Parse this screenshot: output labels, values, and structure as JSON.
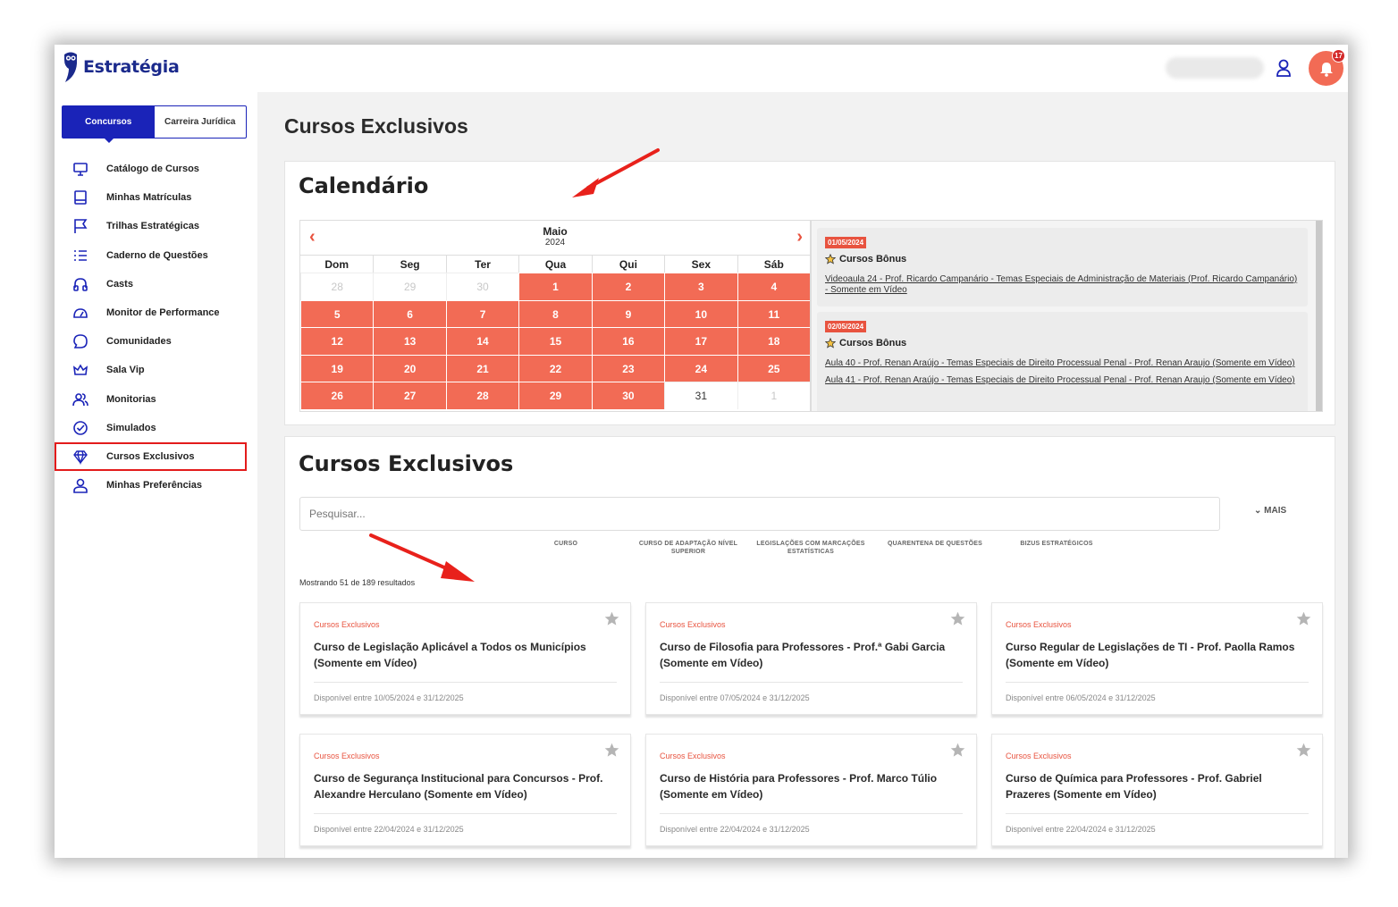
{
  "brand": {
    "name": "Estratégia"
  },
  "header": {
    "notifications_count": "17"
  },
  "sidebar": {
    "tabs": [
      {
        "label": "Concursos"
      },
      {
        "label": "Carreira Jurídica"
      }
    ],
    "items": [
      {
        "label": "Catálogo de Cursos",
        "icon": "monitor-icon"
      },
      {
        "label": "Minhas Matrículas",
        "icon": "book-icon"
      },
      {
        "label": "Trilhas Estratégicas",
        "icon": "flag-icon"
      },
      {
        "label": "Caderno de Questões",
        "icon": "list-icon"
      },
      {
        "label": "Casts",
        "icon": "headphones-icon"
      },
      {
        "label": "Monitor de Performance",
        "icon": "gauge-icon"
      },
      {
        "label": "Comunidades",
        "icon": "chat-icon"
      },
      {
        "label": "Sala Vip",
        "icon": "crown-icon"
      },
      {
        "label": "Monitorias",
        "icon": "users-icon"
      },
      {
        "label": "Simulados",
        "icon": "check-circle-icon"
      },
      {
        "label": "Cursos Exclusivos",
        "icon": "diamond-icon"
      },
      {
        "label": "Minhas Preferências",
        "icon": "user-icon"
      }
    ]
  },
  "main": {
    "title": "Cursos Exclusivos"
  },
  "calendar": {
    "title": "Calendário",
    "month": "Maio",
    "year": "2024",
    "weekdays": [
      "Dom",
      "Seg",
      "Ter",
      "Qua",
      "Qui",
      "Sex",
      "Sáb"
    ],
    "days": [
      {
        "d": "28",
        "s": "other"
      },
      {
        "d": "29",
        "s": "other"
      },
      {
        "d": "30",
        "s": "other"
      },
      {
        "d": "1",
        "s": "ev"
      },
      {
        "d": "2",
        "s": "ev"
      },
      {
        "d": "3",
        "s": "ev"
      },
      {
        "d": "4",
        "s": "ev"
      },
      {
        "d": "5",
        "s": "ev"
      },
      {
        "d": "6",
        "s": "ev"
      },
      {
        "d": "7",
        "s": "ev"
      },
      {
        "d": "8",
        "s": "ev"
      },
      {
        "d": "9",
        "s": "ev"
      },
      {
        "d": "10",
        "s": "ev"
      },
      {
        "d": "11",
        "s": "ev"
      },
      {
        "d": "12",
        "s": "ev"
      },
      {
        "d": "13",
        "s": "ev"
      },
      {
        "d": "14",
        "s": "ev"
      },
      {
        "d": "15",
        "s": "ev"
      },
      {
        "d": "16",
        "s": "ev"
      },
      {
        "d": "17",
        "s": "ev"
      },
      {
        "d": "18",
        "s": "ev"
      },
      {
        "d": "19",
        "s": "ev"
      },
      {
        "d": "20",
        "s": "ev"
      },
      {
        "d": "21",
        "s": "ev"
      },
      {
        "d": "22",
        "s": "ev"
      },
      {
        "d": "23",
        "s": "ev"
      },
      {
        "d": "24",
        "s": "ev"
      },
      {
        "d": "25",
        "s": "ev"
      },
      {
        "d": "26",
        "s": "ev"
      },
      {
        "d": "27",
        "s": "ev"
      },
      {
        "d": "28",
        "s": "ev"
      },
      {
        "d": "29",
        "s": "ev"
      },
      {
        "d": "30",
        "s": "ev"
      },
      {
        "d": "31",
        "s": "plain"
      },
      {
        "d": "1",
        "s": "other"
      }
    ],
    "events": [
      {
        "date": "01/05/2024",
        "type": "Cursos Bônus",
        "links": [
          "Videoaula 24 - Prof. Ricardo Campanário - Temas Especiais de Administração de Materiais (Prof. Ricardo Campanário) - Somente em Vídeo"
        ]
      },
      {
        "date": "02/05/2024",
        "type": "Cursos Bônus",
        "links": [
          "Aula 40 - Prof. Renan Araújo - Temas Especiais de Direito Processual Penal - Prof. Renan Araujo (Somente em Vídeo)",
          "Aula 41 - Prof. Renan Araújo - Temas Especiais de Direito Processual Penal - Prof. Renan Araujo (Somente em Vídeo)"
        ]
      }
    ]
  },
  "list": {
    "title": "Cursos Exclusivos",
    "search_placeholder": "Pesquisar...",
    "more_label": "MAIS",
    "filters": [
      "CURSO",
      "CURSO DE ADAPTAÇÃO NÍVEL SUPERIOR",
      "LEGISLAÇÕES COM MARCAÇÕES ESTATÍSTICAS",
      "QUARENTENA DE QUESTÕES",
      "BIZUS ESTRATÉGICOS"
    ],
    "result_count": "Mostrando 51 de 189 resultados",
    "cards": [
      {
        "category": "Cursos Exclusivos",
        "title": "Curso de Legislação Aplicável a Todos os Municípios (Somente em Vídeo)",
        "available": "Disponível entre 10/05/2024 e 31/12/2025"
      },
      {
        "category": "Cursos Exclusivos",
        "title": "Curso de Filosofia para Professores - Prof.ª Gabi Garcia (Somente em Vídeo)",
        "available": "Disponível entre 07/05/2024 e 31/12/2025"
      },
      {
        "category": "Cursos Exclusivos",
        "title": "Curso Regular de Legislações de TI - Prof. Paolla Ramos (Somente em Vídeo)",
        "available": "Disponível entre 06/05/2024 e 31/12/2025"
      },
      {
        "category": "Cursos Exclusivos",
        "title": "Curso de Segurança Institucional para Concursos - Prof. Alexandre Herculano (Somente em Vídeo)",
        "available": "Disponível entre 22/04/2024 e 31/12/2025"
      },
      {
        "category": "Cursos Exclusivos",
        "title": "Curso de História para Professores - Prof. Marco Túlio (Somente em Vídeo)",
        "available": "Disponível entre 22/04/2024 e 31/12/2025"
      },
      {
        "category": "Cursos Exclusivos",
        "title": "Curso de Química para Professores - Prof. Gabriel Prazeres (Somente em Vídeo)",
        "available": "Disponível entre 22/04/2024 e 31/12/2025"
      }
    ]
  },
  "colors": {
    "accent": "#f26b55",
    "brand_blue": "#1a23b8",
    "highlight_red": "#e31b1b"
  }
}
